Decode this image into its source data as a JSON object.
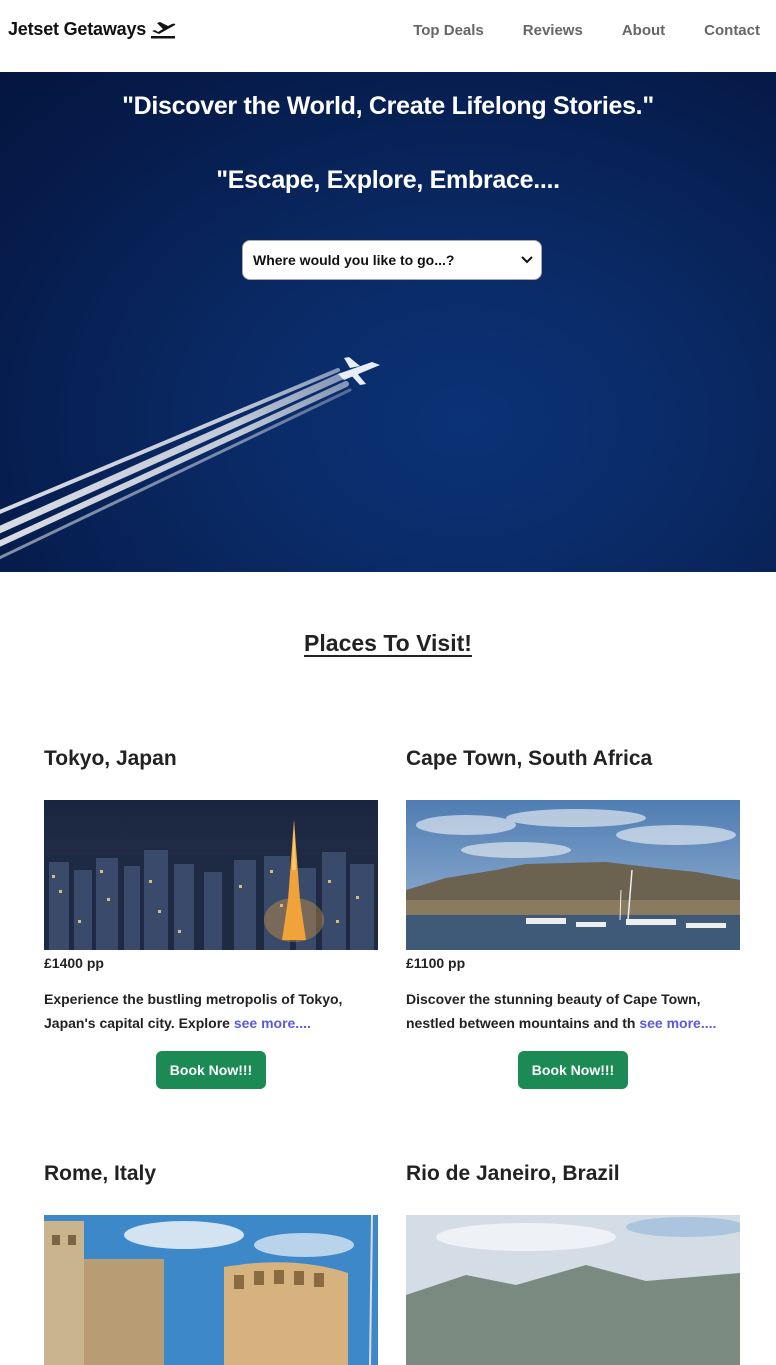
{
  "nav": {
    "brand": "Jetset Getaways",
    "links": [
      "Top Deals",
      "Reviews",
      "About",
      "Contact"
    ]
  },
  "hero": {
    "title_1": "\"Discover the World, Create Lifelong Stories.\"",
    "title_2": "\"Escape, Explore, Embrace....",
    "select_value": "Where would you like to go...?"
  },
  "section": {
    "title": "Places To Visit!"
  },
  "cards": [
    {
      "title": "Tokyo, Japan",
      "price": "£1400 pp",
      "description": "Experience the bustling metropolis of Tokyo, Japan's capital city. Explore ",
      "see_more": "see more....",
      "book_label": "Book Now!!!"
    },
    {
      "title": "Cape Town, South Africa",
      "price": "£1100 pp",
      "description": "Discover the stunning beauty of Cape Town, nestled between mountains and th ",
      "see_more": "see more....",
      "book_label": "Book Now!!!"
    },
    {
      "title": "Rome, Italy"
    },
    {
      "title": "Rio de Janeiro, Brazil"
    }
  ],
  "colors": {
    "hero_bg": "#0a2a66",
    "book_button": "#1b8a55",
    "see_more_link": "#5a5ae0",
    "nav_link": "#666666"
  },
  "icons": {
    "brand": "airplane-takeoff-icon",
    "select": "chevron-down-icon"
  }
}
